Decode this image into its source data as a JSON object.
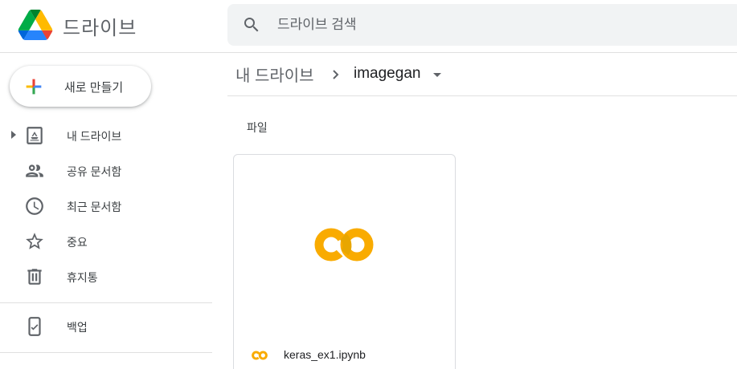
{
  "app": {
    "title": "드라이브",
    "logo_icon": "google-drive-logo"
  },
  "search": {
    "placeholder": "드라이브 검색",
    "value": "",
    "icon": "search-icon"
  },
  "new_button": {
    "label": "새로 만들기",
    "icon": "plus-icon"
  },
  "sidebar": {
    "items": [
      {
        "label": "내 드라이브",
        "icon": "my-drive-icon",
        "expandable": true
      },
      {
        "label": "공유 문서함",
        "icon": "people-icon"
      },
      {
        "label": "최근 문서함",
        "icon": "clock-icon"
      },
      {
        "label": "중요",
        "icon": "star-icon"
      },
      {
        "label": "휴지통",
        "icon": "trash-icon"
      },
      {
        "label": "백업",
        "icon": "backup-phone-icon"
      }
    ]
  },
  "breadcrumb": {
    "root": "내 드라이브",
    "current": "imagegan"
  },
  "files_section": {
    "label": "파일",
    "files": [
      {
        "name": "keras_ex1.ipynb",
        "icon": "colab-icon"
      }
    ]
  },
  "colors": {
    "blue": "#4285F4",
    "red": "#EA4335",
    "yellow": "#FBBC04",
    "green": "#34A853",
    "colab_orange": "#F9AB00",
    "colab_yellow": "#E8710A",
    "text_secondary": "#5f6368",
    "search_bg": "#f1f3f4"
  }
}
